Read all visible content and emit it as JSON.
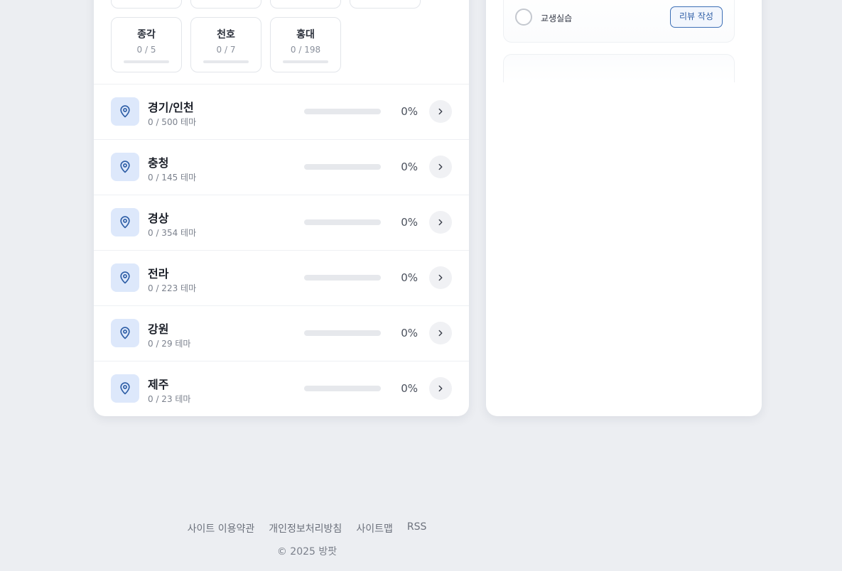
{
  "colors": {
    "background": "#eceef2",
    "card": "#ffffff",
    "accent": "#3d6fb6",
    "icon_bg": "#dde8fb"
  },
  "chips": [
    {
      "name": "종각",
      "count": "0 / 5",
      "progress_pct": 0
    },
    {
      "name": "천호",
      "count": "0 / 7",
      "progress_pct": 0
    },
    {
      "name": "홍대",
      "count": "0 / 198",
      "progress_pct": 0
    }
  ],
  "regions": [
    {
      "name": "경기/인천",
      "sub": "0 / 500 테마",
      "pct": "0%",
      "progress_pct": 0,
      "icon": "map-pin-icon"
    },
    {
      "name": "충청",
      "sub": "0 / 145 테마",
      "pct": "0%",
      "progress_pct": 0,
      "icon": "map-pin-icon"
    },
    {
      "name": "경상",
      "sub": "0 / 354 테마",
      "pct": "0%",
      "progress_pct": 0,
      "icon": "map-pin-icon"
    },
    {
      "name": "전라",
      "sub": "0 / 223 테마",
      "pct": "0%",
      "progress_pct": 0,
      "icon": "map-pin-icon"
    },
    {
      "name": "강원",
      "sub": "0 / 29 테마",
      "pct": "0%",
      "progress_pct": 0,
      "icon": "map-pin-icon"
    },
    {
      "name": "제주",
      "sub": "0 / 23 테마",
      "pct": "0%",
      "progress_pct": 0,
      "icon": "map-pin-icon"
    }
  ],
  "tasks": {
    "row": {
      "title": "교생실습",
      "review_label": "리뷰 작성"
    }
  },
  "footer": {
    "links": [
      "사이트 이용약관",
      "개인정보처리방침",
      "사이트맵",
      "RSS"
    ],
    "copyright": "© 2025 방팟"
  }
}
